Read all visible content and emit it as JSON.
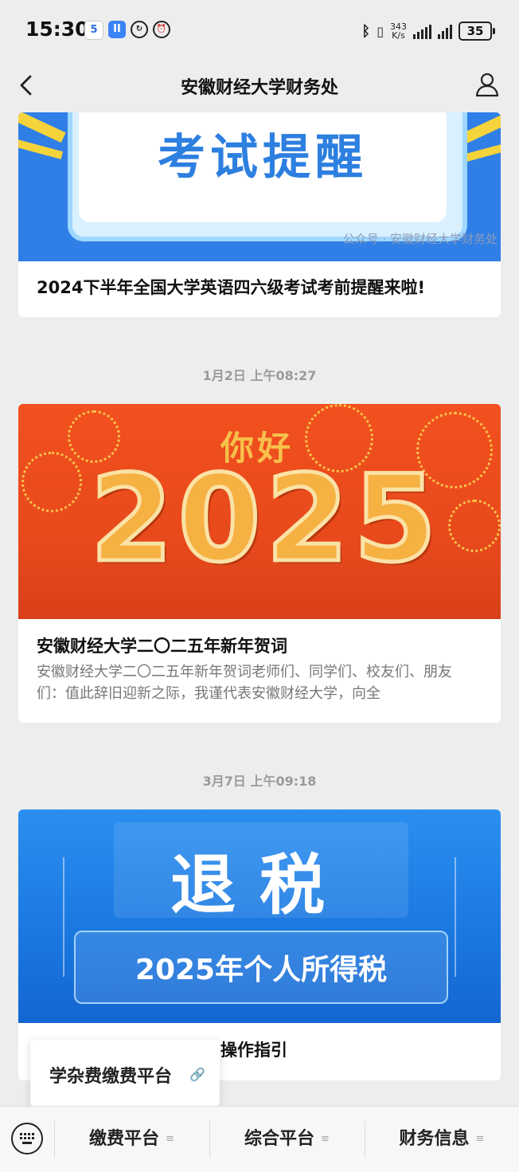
{
  "status_bar": {
    "time": "15:30",
    "net_speed_value": "343",
    "net_speed_unit": "K/s",
    "battery": "35"
  },
  "nav": {
    "title": "安徽财经大学财务处"
  },
  "articles": [
    {
      "banner_text": "考试提醒",
      "watermark": "公众号 · 安徽财经大学财务处",
      "title": "2024下半年全国大学英语四六级考试考前提醒来啦!"
    },
    {
      "timestamp": "1月2日 上午08:27",
      "banner_hello": "你好",
      "banner_year": "2025",
      "title": "安徽财经大学二〇二五年新年贺词",
      "description": "安徽财经大学二〇二五年新年贺词老师们、同学们、校友们、朋友们：值此辞旧迎新之际，我谨代表安徽财经大学，向全"
    },
    {
      "timestamp": "3月7日 上午09:18",
      "banner_title": "退税",
      "banner_subtitle": "2025年个人所得税",
      "title_visible_tail": "操作指引"
    }
  ],
  "popup": {
    "label": "学杂费缴费平台"
  },
  "bottom_menu": {
    "items": [
      "缴费平台",
      "综合平台",
      "财务信息"
    ]
  },
  "colors": {
    "page_bg": "#ededed",
    "card_bg": "#ffffff",
    "banner1_blue": "#2f7fe6",
    "banner2_red": "#e84a1c",
    "banner3_blue": "#1a77e0"
  }
}
